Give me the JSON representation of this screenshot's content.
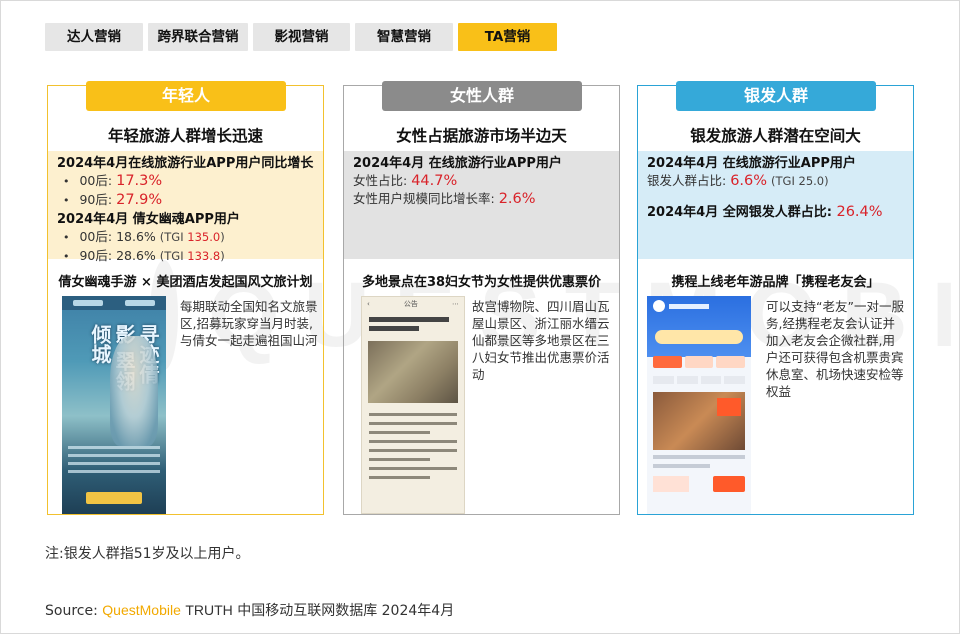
{
  "tabs": [
    {
      "label": "达人营销",
      "active": false
    },
    {
      "label": "跨界联合营销",
      "active": false
    },
    {
      "label": "影视营销",
      "active": false
    },
    {
      "label": "智慧营销",
      "active": false
    },
    {
      "label": "TA营销",
      "active": true
    }
  ],
  "watermark": {
    "text": "QUESTMOBILE"
  },
  "cards": [
    {
      "pill": "年轻人",
      "title": "年轻旅游人群增长迅速",
      "stat_head_1": "2024年4月在线旅游行业APP用户同比增长",
      "line_1_label": "00后:",
      "line_1_value": "17.3%",
      "line_2_label": "90后:",
      "line_2_value": "27.9%",
      "stat_head_2": "2024年4月 倩女幽魂APP用户",
      "line_3_label": "00后:",
      "line_3_value": "18.6%",
      "line_3_tgi_label": "(TGI",
      "line_3_tgi": "135.0",
      "line_4_label": "90后:",
      "line_4_value": "28.6%",
      "line_4_tgi_label": "(TGI",
      "line_4_tgi": "133.8",
      "tgi_close": ")",
      "case_title": "倩女幽魂手游 × 美团酒店发起国风文旅计划",
      "desc": "每期联动全国知名文旅景区,招募玩家穿当月时装,与倩女一起走遍祖国山河",
      "shot_art_text": "寻迹倩影 翠翎倾城"
    },
    {
      "pill": "女性人群",
      "title": "女性占据旅游市场半边天",
      "stat_head_1": "2024年4月 在线旅游行业APP用户",
      "line_1_label": "女性占比:",
      "line_1_value": "44.7%",
      "line_2_label": "女性用户规模同比增长率:",
      "line_2_value": "2.6%",
      "case_title": "多地景点在38妇女节为女性提供优惠票价",
      "desc": "故宫博物院、四川眉山瓦屋山景区、浙江丽水缙云仙都景区等多地景区在三八妇女节推出优惠票价活动",
      "shot_nav_label": "公告"
    },
    {
      "pill": "银发人群",
      "title": "银发旅游人群潜在空间大",
      "stat_head_1": "2024年4月 在线旅游行业APP用户",
      "line_1_label": "银发人群占比:",
      "line_1_value": "6.6%",
      "line_1_tgi": "(TGI 25.0)",
      "stat_head_2": "2024年4月 全网银发人群占比:",
      "stat_head_2_value": "26.4%",
      "case_title": "携程上线老年游品牌「携程老友会」",
      "desc": "可以支持“老友”一对一服务,经携程老友会认证并加入老友会企微社群,用户还可获得包含机票贵宾休息室、机场快速安检等权益"
    }
  ],
  "note": "注:银发人群指51岁及以上用户。",
  "source": {
    "prefix": "Source:",
    "brand": "QuestMobile",
    "product": "TRUTH",
    "rest": "中国移动互联网数据库 2024年4月"
  },
  "colors": {
    "accent_yellow": "#f9c018",
    "accent_gray": "#8b8b8b",
    "accent_blue": "#35a9d9",
    "highlight_red": "#d9232a",
    "brand_orange": "#f2a900"
  }
}
